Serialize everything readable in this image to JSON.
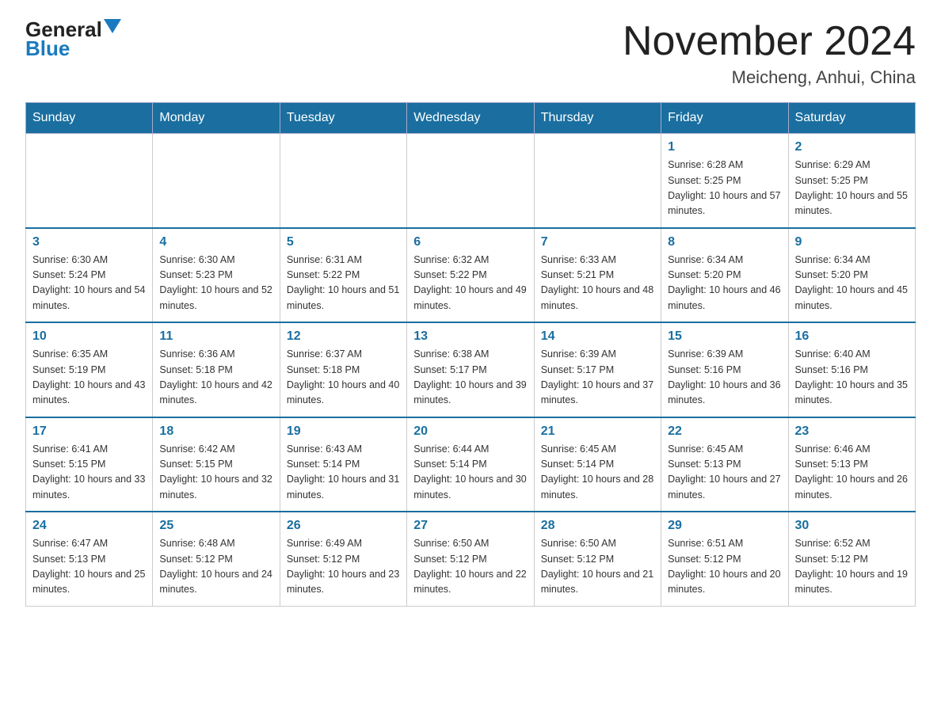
{
  "header": {
    "logo_general": "General",
    "logo_blue": "Blue",
    "month_title": "November 2024",
    "location": "Meicheng, Anhui, China"
  },
  "days_of_week": [
    "Sunday",
    "Monday",
    "Tuesday",
    "Wednesday",
    "Thursday",
    "Friday",
    "Saturday"
  ],
  "weeks": [
    [
      {
        "day": "",
        "info": ""
      },
      {
        "day": "",
        "info": ""
      },
      {
        "day": "",
        "info": ""
      },
      {
        "day": "",
        "info": ""
      },
      {
        "day": "",
        "info": ""
      },
      {
        "day": "1",
        "info": "Sunrise: 6:28 AM\nSunset: 5:25 PM\nDaylight: 10 hours and 57 minutes."
      },
      {
        "day": "2",
        "info": "Sunrise: 6:29 AM\nSunset: 5:25 PM\nDaylight: 10 hours and 55 minutes."
      }
    ],
    [
      {
        "day": "3",
        "info": "Sunrise: 6:30 AM\nSunset: 5:24 PM\nDaylight: 10 hours and 54 minutes."
      },
      {
        "day": "4",
        "info": "Sunrise: 6:30 AM\nSunset: 5:23 PM\nDaylight: 10 hours and 52 minutes."
      },
      {
        "day": "5",
        "info": "Sunrise: 6:31 AM\nSunset: 5:22 PM\nDaylight: 10 hours and 51 minutes."
      },
      {
        "day": "6",
        "info": "Sunrise: 6:32 AM\nSunset: 5:22 PM\nDaylight: 10 hours and 49 minutes."
      },
      {
        "day": "7",
        "info": "Sunrise: 6:33 AM\nSunset: 5:21 PM\nDaylight: 10 hours and 48 minutes."
      },
      {
        "day": "8",
        "info": "Sunrise: 6:34 AM\nSunset: 5:20 PM\nDaylight: 10 hours and 46 minutes."
      },
      {
        "day": "9",
        "info": "Sunrise: 6:34 AM\nSunset: 5:20 PM\nDaylight: 10 hours and 45 minutes."
      }
    ],
    [
      {
        "day": "10",
        "info": "Sunrise: 6:35 AM\nSunset: 5:19 PM\nDaylight: 10 hours and 43 minutes."
      },
      {
        "day": "11",
        "info": "Sunrise: 6:36 AM\nSunset: 5:18 PM\nDaylight: 10 hours and 42 minutes."
      },
      {
        "day": "12",
        "info": "Sunrise: 6:37 AM\nSunset: 5:18 PM\nDaylight: 10 hours and 40 minutes."
      },
      {
        "day": "13",
        "info": "Sunrise: 6:38 AM\nSunset: 5:17 PM\nDaylight: 10 hours and 39 minutes."
      },
      {
        "day": "14",
        "info": "Sunrise: 6:39 AM\nSunset: 5:17 PM\nDaylight: 10 hours and 37 minutes."
      },
      {
        "day": "15",
        "info": "Sunrise: 6:39 AM\nSunset: 5:16 PM\nDaylight: 10 hours and 36 minutes."
      },
      {
        "day": "16",
        "info": "Sunrise: 6:40 AM\nSunset: 5:16 PM\nDaylight: 10 hours and 35 minutes."
      }
    ],
    [
      {
        "day": "17",
        "info": "Sunrise: 6:41 AM\nSunset: 5:15 PM\nDaylight: 10 hours and 33 minutes."
      },
      {
        "day": "18",
        "info": "Sunrise: 6:42 AM\nSunset: 5:15 PM\nDaylight: 10 hours and 32 minutes."
      },
      {
        "day": "19",
        "info": "Sunrise: 6:43 AM\nSunset: 5:14 PM\nDaylight: 10 hours and 31 minutes."
      },
      {
        "day": "20",
        "info": "Sunrise: 6:44 AM\nSunset: 5:14 PM\nDaylight: 10 hours and 30 minutes."
      },
      {
        "day": "21",
        "info": "Sunrise: 6:45 AM\nSunset: 5:14 PM\nDaylight: 10 hours and 28 minutes."
      },
      {
        "day": "22",
        "info": "Sunrise: 6:45 AM\nSunset: 5:13 PM\nDaylight: 10 hours and 27 minutes."
      },
      {
        "day": "23",
        "info": "Sunrise: 6:46 AM\nSunset: 5:13 PM\nDaylight: 10 hours and 26 minutes."
      }
    ],
    [
      {
        "day": "24",
        "info": "Sunrise: 6:47 AM\nSunset: 5:13 PM\nDaylight: 10 hours and 25 minutes."
      },
      {
        "day": "25",
        "info": "Sunrise: 6:48 AM\nSunset: 5:12 PM\nDaylight: 10 hours and 24 minutes."
      },
      {
        "day": "26",
        "info": "Sunrise: 6:49 AM\nSunset: 5:12 PM\nDaylight: 10 hours and 23 minutes."
      },
      {
        "day": "27",
        "info": "Sunrise: 6:50 AM\nSunset: 5:12 PM\nDaylight: 10 hours and 22 minutes."
      },
      {
        "day": "28",
        "info": "Sunrise: 6:50 AM\nSunset: 5:12 PM\nDaylight: 10 hours and 21 minutes."
      },
      {
        "day": "29",
        "info": "Sunrise: 6:51 AM\nSunset: 5:12 PM\nDaylight: 10 hours and 20 minutes."
      },
      {
        "day": "30",
        "info": "Sunrise: 6:52 AM\nSunset: 5:12 PM\nDaylight: 10 hours and 19 minutes."
      }
    ]
  ]
}
